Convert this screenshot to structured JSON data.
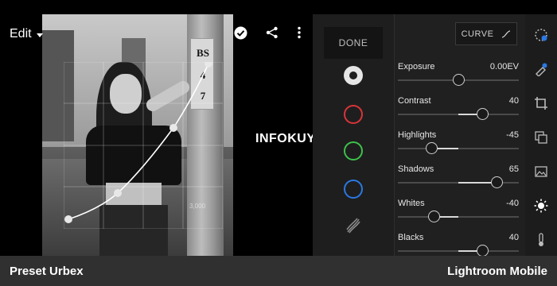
{
  "header": {
    "edit_label": "Edit"
  },
  "icons": {
    "edit_caret": "chevron-down-icon",
    "confirm": "checkmark-circle-icon",
    "share": "share-icon",
    "more": "more-vertical-icon"
  },
  "photo_overlay": {
    "poster_text": "BS\n4\n7",
    "curve_readout": "3,000"
  },
  "watermark": "INFOKUY.NET",
  "tool_column": {
    "done_label": "DONE",
    "channels": [
      {
        "name": "rgb",
        "color": "#e6e6e6"
      },
      {
        "name": "red",
        "color": "#d9343a"
      },
      {
        "name": "green",
        "color": "#3cc24a"
      },
      {
        "name": "blue",
        "color": "#2a78e0"
      }
    ]
  },
  "adjustments": {
    "curve_label": "CURVE",
    "rows": [
      {
        "label": "Exposure",
        "value": "0.00EV",
        "level": 0.5
      },
      {
        "label": "Contrast",
        "value": "40",
        "level": 0.7
      },
      {
        "label": "Highlights",
        "value": "-45",
        "level": 0.28
      },
      {
        "label": "Shadows",
        "value": "65",
        "level": 0.82
      },
      {
        "label": "Whites",
        "value": "-40",
        "level": 0.3
      },
      {
        "label": "Blacks",
        "value": "40",
        "level": 0.7
      }
    ]
  },
  "icon_rail": [
    "auto-icon",
    "selective-brush-icon",
    "crop-icon",
    "profiles-icon",
    "light-icon",
    "temperature-icon"
  ],
  "accent_colors": {
    "red": "#d9343a",
    "green": "#3cc24a",
    "blue": "#2a78e0",
    "auto_blue": "#2a78e0"
  },
  "caption": {
    "left": "Preset Urbex",
    "right": "Lightroom Mobile"
  }
}
